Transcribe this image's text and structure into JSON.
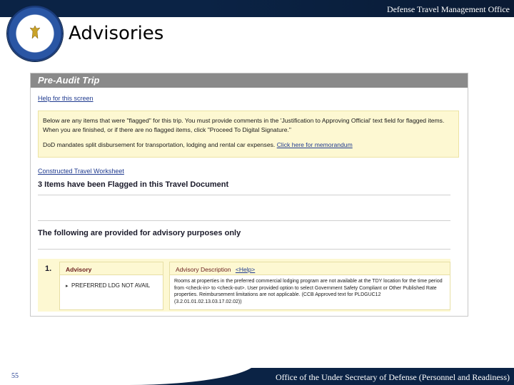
{
  "header": {
    "org_title": "Defense Travel Management Office",
    "page_title": "Advisories",
    "seal_icon": "dod-seal-icon"
  },
  "screen": {
    "window_title": "Pre-Audit Trip",
    "help_link": "Help for this screen",
    "notice": {
      "paragraph1": "Below are any items that were \"flagged\" for this trip. You must provide comments in the 'Justification to Approving Official' text field for flagged items. When you are finished, or if there are no flagged items, click \"Proceed To Digital Signature.\"",
      "paragraph2_text": "DoD mandates split disbursement for transportation, lodging and rental car expenses.",
      "paragraph2_link": "Click here for memorandum"
    },
    "worksheet_link": "Constructed Travel Worksheet",
    "flagged_summary": "3 Items have been Flagged in this Travel Document",
    "advisory_heading": "The following are provided for advisory purposes only",
    "advisories": [
      {
        "number": "1.",
        "column_left_header": "Advisory",
        "item": "PREFERRED LDG NOT AVAIL",
        "column_right_header": "Advisory Description",
        "help_label": "<Help>",
        "description": "Rooms at properties in the preferred commercial lodging program are not available at the TDY location for the time period from <check-in> to <check-out>. User provided option to select Government Safety Compliant or Other Published Rate properties. Reimbursement limitations are not applicable. (CCB Approved text for PLDGUC12 (3.2.01.01.02.13.03.17.02.02))"
      }
    ]
  },
  "footer": {
    "page_number": "55",
    "office": "Office of the Under Secretary of Defense (Personnel and Readiness)"
  },
  "colors": {
    "navy": "#0b2345",
    "notice_bg": "#fdf8d2",
    "link": "#1f3a8f"
  }
}
